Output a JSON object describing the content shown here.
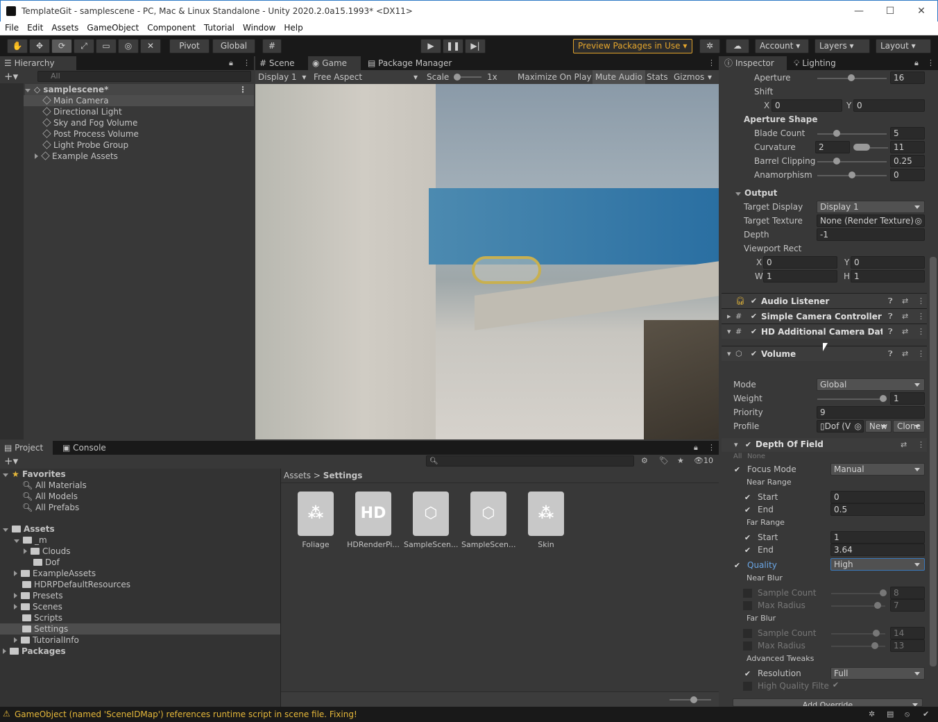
{
  "window": {
    "title": "TemplateGit - samplescene - PC, Mac & Linux Standalone - Unity 2020.2.0a15.1993* <DX11>",
    "min": "—",
    "max": "☐",
    "close": "✕"
  },
  "menu": [
    "File",
    "Edit",
    "Assets",
    "GameObject",
    "Component",
    "Tutorial",
    "Window",
    "Help"
  ],
  "toolbar": {
    "pivot": "Pivot",
    "global": "Global",
    "preview": "Preview Packages in Use",
    "account": "Account",
    "layers": "Layers",
    "layout": "Layout"
  },
  "hierarchy": {
    "tab": "Hierarchy",
    "search": "All",
    "scene": "samplescene*",
    "items": [
      "Main Camera",
      "Directional Light",
      "Sky and Fog Volume",
      "Post Process Volume",
      "Light Probe Group",
      "Example Assets"
    ]
  },
  "game": {
    "tabs": [
      "Scene",
      "Game",
      "Package Manager"
    ],
    "display": "Display 1",
    "aspect": "Free Aspect",
    "scale_label": "Scale",
    "scale": "1x",
    "buttons": [
      "Maximize On Play",
      "Mute Audio",
      "Stats",
      "Gizmos"
    ]
  },
  "inspector": {
    "tabs": [
      "Inspector",
      "Lighting"
    ],
    "aperture": {
      "label": "Aperture",
      "value": "16"
    },
    "shift": {
      "label": "Shift",
      "x_label": "X",
      "x": "0",
      "y_label": "Y",
      "y": "0"
    },
    "aperture_shape": "Aperture Shape",
    "blade_count": {
      "label": "Blade Count",
      "value": "5"
    },
    "curvature": {
      "label": "Curvature",
      "min": "2",
      "max": "11"
    },
    "barrel": {
      "label": "Barrel Clipping",
      "value": "0.25"
    },
    "anamorphism": {
      "label": "Anamorphism",
      "value": "0"
    },
    "output": "Output",
    "target_display": {
      "label": "Target Display",
      "value": "Display 1"
    },
    "target_texture": {
      "label": "Target Texture",
      "value": "None (Render Texture)"
    },
    "depth": {
      "label": "Depth",
      "value": "-1"
    },
    "viewport": {
      "label": "Viewport Rect",
      "x_label": "X",
      "x": "0",
      "y_label": "Y",
      "y": "0",
      "w_label": "W",
      "w": "1",
      "h_label": "H",
      "h": "1"
    },
    "components": [
      "Audio Listener",
      "Simple Camera Controller (Script)",
      "HD Additional Camera Data (Script)",
      "Volume"
    ],
    "volume": {
      "mode_label": "Mode",
      "mode": "Global",
      "weight_label": "Weight",
      "weight": "1",
      "priority_label": "Priority",
      "priority": "9",
      "profile_label": "Profile",
      "profile": "Dof (V",
      "new": "New",
      "clone": "Clone"
    },
    "dof": {
      "title": "Depth Of Field",
      "all": "All",
      "none": "None",
      "focus_label": "Focus Mode",
      "focus": "Manual",
      "near_range": "Near Range",
      "start": "Start",
      "end": "End",
      "near_start": "0",
      "near_end": "0.5",
      "far_range": "Far Range",
      "far_start": "1",
      "far_end": "3.64",
      "quality_label": "Quality",
      "quality": "High",
      "near_blur": "Near Blur",
      "sample_count": "Sample Count",
      "max_radius": "Max Radius",
      "nb_sample": "8",
      "nb_radius": "7",
      "far_blur": "Far Blur",
      "fb_sample": "14",
      "fb_radius": "13",
      "advanced": "Advanced Tweaks",
      "resolution_label": "Resolution",
      "resolution": "Full",
      "hq_label": "High Quality Filteri",
      "add_override": "Add Override"
    }
  },
  "project": {
    "tabs": [
      "Project",
      "Console"
    ],
    "hidden_count": "10",
    "favorites": "Favorites",
    "fav_items": [
      "All Materials",
      "All Models",
      "All Prefabs"
    ],
    "assets": "Assets",
    "tree": [
      "_m",
      "Clouds",
      "Dof",
      "ExampleAssets",
      "HDRPDefaultResources",
      "Presets",
      "Scenes",
      "Scripts",
      "Settings",
      "TutorialInfo"
    ],
    "packages": "Packages",
    "breadcrumb": [
      "Assets",
      "Settings"
    ],
    "files": [
      "Foliage",
      "HDRenderPi...",
      "SampleScen...",
      "SampleScen...",
      "Skin"
    ]
  },
  "status": {
    "message": "GameObject (named 'SceneIDMap') references runtime script in scene file. Fixing!"
  }
}
